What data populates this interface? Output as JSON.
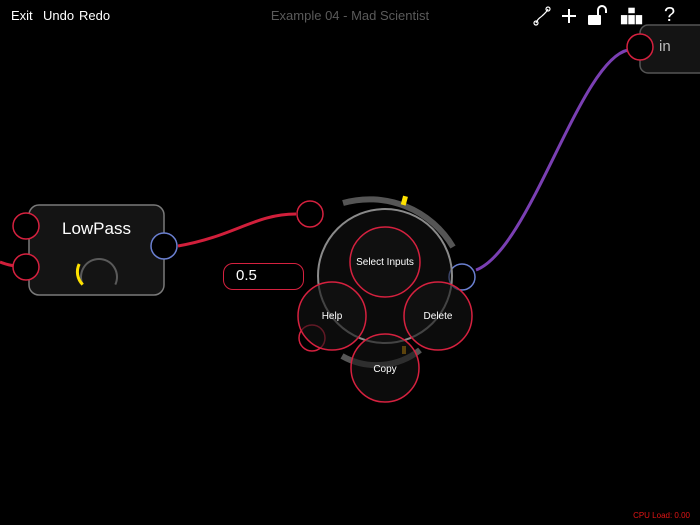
{
  "toolbar": {
    "exit_label": "Exit",
    "undo_label": "Undo",
    "redo_label": "Redo",
    "title": "Example 04 - Mad Scientist",
    "help_label": "?"
  },
  "nodes": {
    "lowpass": {
      "title": "LowPass"
    },
    "input": {
      "title": "in"
    },
    "value": {
      "text": "0.5"
    }
  },
  "radial_menu": {
    "select_inputs": "Select Inputs",
    "help": "Help",
    "delete": "Delete",
    "copy": "Copy"
  },
  "status": {
    "cpu_load": "CPU Load: 0.00"
  },
  "colors": {
    "background": "#000000",
    "port_red": "#d5213f",
    "port_blue": "#6a7fd0",
    "cable_red": "#d11f3b",
    "cable_purple": "#7a3fb3",
    "knob_yellow": "#ffe200",
    "node_border": "#7a7a7a",
    "title_gray": "#5a5a5a",
    "cpu_red": "#e01515"
  },
  "icons": [
    "link-icon",
    "plus-icon",
    "unlock-icon",
    "modules-icon"
  ]
}
